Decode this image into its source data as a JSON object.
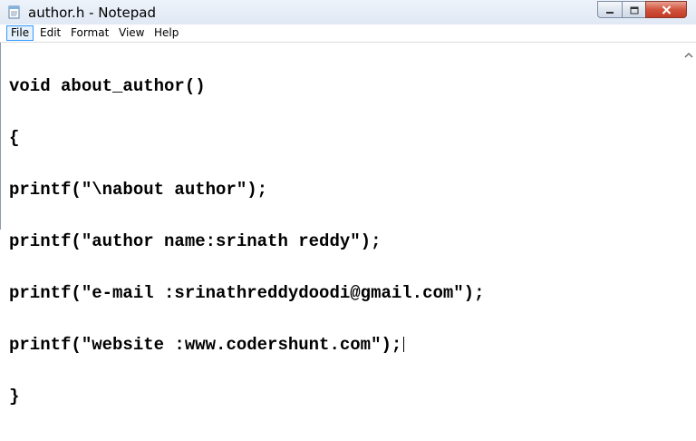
{
  "window": {
    "title": "author.h - Notepad",
    "app_icon": "notepad-icon",
    "caption_buttons": [
      "minimize-icon",
      "maximize-icon",
      "close-icon"
    ]
  },
  "menu": {
    "items": [
      "File",
      "Edit",
      "Format",
      "View",
      "Help"
    ],
    "active_item": "File"
  },
  "editor": {
    "lines": [
      "void about_author()",
      "{",
      "printf(\"\\nabout author\");",
      "printf(\"author name:srinath reddy\");",
      "printf(\"e-mail :srinathreddydoodi@gmail.com\");",
      "printf(\"website :www.codershunt.com\");",
      "}"
    ]
  },
  "scrollbar": {
    "up_arrow": "scroll-up-arrow-icon"
  },
  "colors": {
    "titlebar": "#dfe8f4",
    "close_button": "#c23b25",
    "menu_highlight": "#e5f1fb",
    "menu_highlight_border": "#3399ff",
    "text": "#000000"
  }
}
